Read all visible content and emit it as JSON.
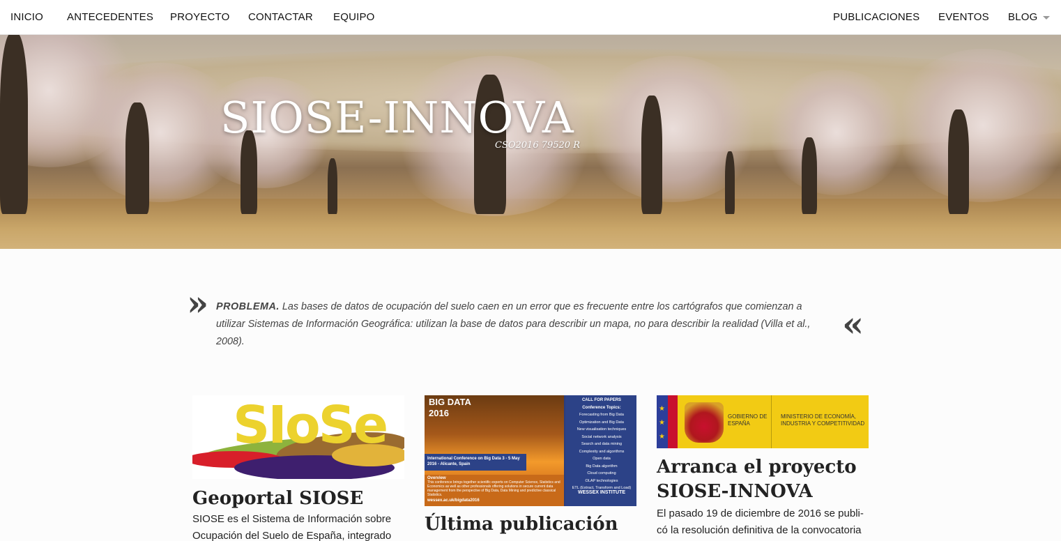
{
  "nav": {
    "left": [
      "INICIO",
      "ANTECEDENTES",
      "PROYECTO",
      "CONTACTAR",
      "EQUIPO"
    ],
    "right": [
      "PUBLICACIONES",
      "EVENTOS",
      "BLOG"
    ]
  },
  "hero": {
    "title": "SIOSE-INNOVA",
    "subtitle": "CSO2016 79520 R"
  },
  "quote": {
    "open_mark": "»",
    "close_mark": "«",
    "label": "PROBLEMA.",
    "text": "Las bases de datos de ocupación del suelo caen en un error que es frecuente entre los cartógrafos que comienzan a utilizar Sistemas de Información Geográfica: utilizan la base de datos para describir un mapa, no para describir la realidad (Villa et al., 2008)."
  },
  "cards": [
    {
      "title": "Geoportal SIOSE",
      "text": "SIOSE es el Sistema de Información sobre Ocupación del Suelo de España, integrado",
      "logo_text": "SIoSe"
    },
    {
      "title": "Última publicación",
      "poster": {
        "tag": "BIG DATA 2016",
        "band": "International Conference on Big Data 3 - 5 May 2016 - Alicante, Spain",
        "overview_label": "Overview",
        "overview_text": "This conference brings together scientific experts on Computer Science, Statistics and Economics as well as other professionals offering solutions in secure current data management from the perspective of Big Data, Data Mining and predictive classical Statistics.",
        "url": "wessex.ac.uk/bigdata2016",
        "cfp_title": "CALL FOR PAPERS",
        "topics_title": "Conference Topics:",
        "topics": [
          "Forecasting from Big Data",
          "Optimization and Big Data",
          "New visualisation techniques",
          "Social network analysis",
          "Search and data mining",
          "Complexity and algorithms",
          "Open data",
          "Big Data algorithm",
          "Cloud computing",
          "OLAP technologies",
          "ETL (Extract, Transform and Load)"
        ],
        "institute": "WESSEX INSTITUTE"
      }
    },
    {
      "title": "Arranca el proyecto SIOSE-INNOVA",
      "text": "El pasado 19 de diciembre de 2016 se publi-có la resolución definitiva de la convocatoria",
      "logo": {
        "line1": "GOBIERNO DE ESPAÑA",
        "line2": "MINISTERIO DE ECONOMÍA, INDUSTRIA Y COMPETITIVIDAD"
      }
    }
  ],
  "colors": {
    "nav_bg": "#ffffff",
    "text": "#222222",
    "siose_yellow": "#ecd22e",
    "bigdata_orange": "#c86a19",
    "wessex_blue": "#2c4287",
    "gob_yellow": "#f2cb14"
  }
}
